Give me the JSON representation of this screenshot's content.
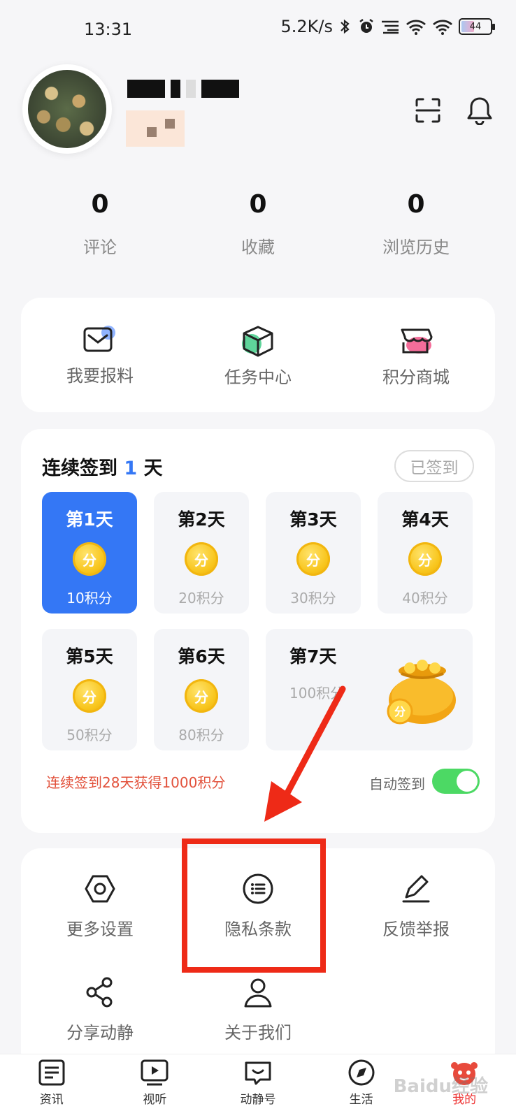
{
  "status_bar": {
    "time": "13:31",
    "speed": "5.2K/s",
    "battery": "44"
  },
  "header": {
    "scan_icon": "scan-icon",
    "bell_icon": "bell-icon"
  },
  "stats": [
    {
      "value": "0",
      "label": "评论"
    },
    {
      "value": "0",
      "label": "收藏"
    },
    {
      "value": "0",
      "label": "浏览历史"
    }
  ],
  "quick_actions": [
    {
      "label": "我要报料",
      "icon": "mail-icon"
    },
    {
      "label": "任务中心",
      "icon": "box-icon"
    },
    {
      "label": "积分商城",
      "icon": "store-icon"
    }
  ],
  "sign_in": {
    "title_prefix": "连续签到",
    "days_count": "1",
    "title_suffix": "天",
    "signed_button": "已签到",
    "coin_text": "分",
    "days": [
      {
        "label": "第1天",
        "points": "10积分",
        "active": true
      },
      {
        "label": "第2天",
        "points": "20积分"
      },
      {
        "label": "第3天",
        "points": "30积分"
      },
      {
        "label": "第4天",
        "points": "40积分"
      },
      {
        "label": "第5天",
        "points": "50积分"
      },
      {
        "label": "第6天",
        "points": "80积分"
      },
      {
        "label": "第7天",
        "points": "100积分"
      }
    ],
    "promo": "连续签到28天获得1000积分",
    "auto_label": "自动签到",
    "auto_enabled": true
  },
  "menu": [
    {
      "label": "更多设置",
      "icon": "hexagon-settings-icon"
    },
    {
      "label": "隐私条款",
      "icon": "list-circle-icon"
    },
    {
      "label": "反馈举报",
      "icon": "pen-icon"
    },
    {
      "label": "分享动静",
      "icon": "share-icon"
    },
    {
      "label": "关于我们",
      "icon": "person-icon"
    }
  ],
  "tabs": [
    {
      "label": "资讯",
      "icon": "news-icon"
    },
    {
      "label": "视听",
      "icon": "video-icon"
    },
    {
      "label": "动静号",
      "icon": "chat-smile-icon"
    },
    {
      "label": "生活",
      "icon": "compass-icon"
    },
    {
      "label": "我的",
      "icon": "mascot-icon",
      "active": true
    }
  ],
  "watermark": "Baidu经验",
  "colors": {
    "accent": "#3477f5",
    "promo": "#e2513b",
    "toggle": "#4cd964",
    "annotation": "#ee2a17"
  }
}
